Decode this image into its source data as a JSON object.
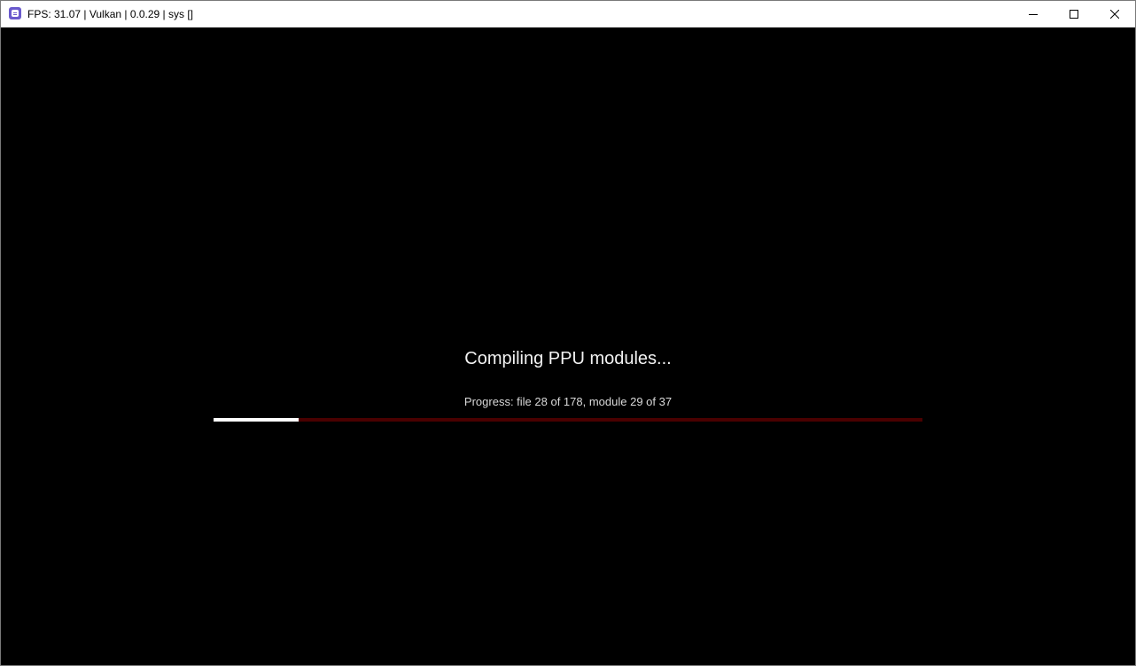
{
  "window": {
    "title": "FPS: 31.07 | Vulkan | 0.0.29 | sys []",
    "app_icon": "rpcs3-icon",
    "controls": [
      "minimize-icon",
      "maximize-icon",
      "close-icon"
    ]
  },
  "overlay": {
    "headline": "Compiling PPU modules...",
    "progress_text": "Progress: file 28 of 178, module 29 of 37",
    "progress_fraction": 0.12,
    "colors": {
      "track": "#4a0000",
      "fill": "#ffffff"
    }
  }
}
